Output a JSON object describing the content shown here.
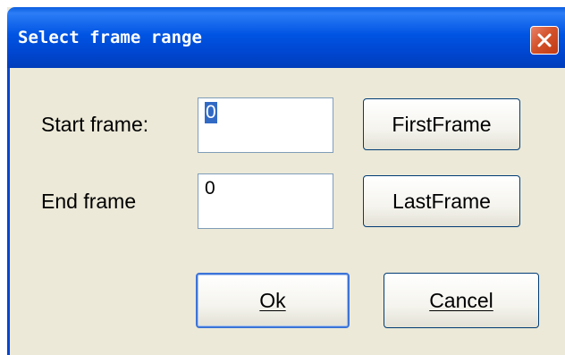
{
  "dialog": {
    "title": "Select frame range",
    "close_icon": "close-icon"
  },
  "fields": {
    "start_label": "Start frame:",
    "start_value": "0",
    "end_label": "End frame",
    "end_value": "0"
  },
  "buttons": {
    "first_frame": "FirstFrame",
    "last_frame": "LastFrame",
    "ok": "Ok",
    "cancel": "Cancel"
  },
  "colors": {
    "titlebar": "#0054e3",
    "dialog_bg": "#ece9d8",
    "close_button": "#d4532c",
    "selection": "#316ac5"
  }
}
